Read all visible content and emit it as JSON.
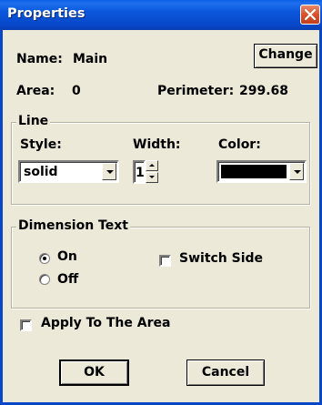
{
  "window": {
    "title": "Properties"
  },
  "name": {
    "label": "Name:",
    "value": "Main"
  },
  "change_button": "Change",
  "area": {
    "label": "Area:",
    "value": "0"
  },
  "perimeter": {
    "label": "Perimeter:",
    "value": "299.68"
  },
  "line_group": {
    "title": "Line",
    "style_label": "Style:",
    "style_value": "solid",
    "width_label": "Width:",
    "width_value": "1",
    "color_label": "Color:",
    "color_value": "#000000"
  },
  "dimension_group": {
    "title": "Dimension Text",
    "on_label": "On",
    "off_label": "Off",
    "selected": "On",
    "switch_side_label": "Switch Side",
    "switch_side_checked": false
  },
  "apply_to_area": {
    "label": "Apply To The Area",
    "checked": false
  },
  "ok_button": "OK",
  "cancel_button": "Cancel"
}
